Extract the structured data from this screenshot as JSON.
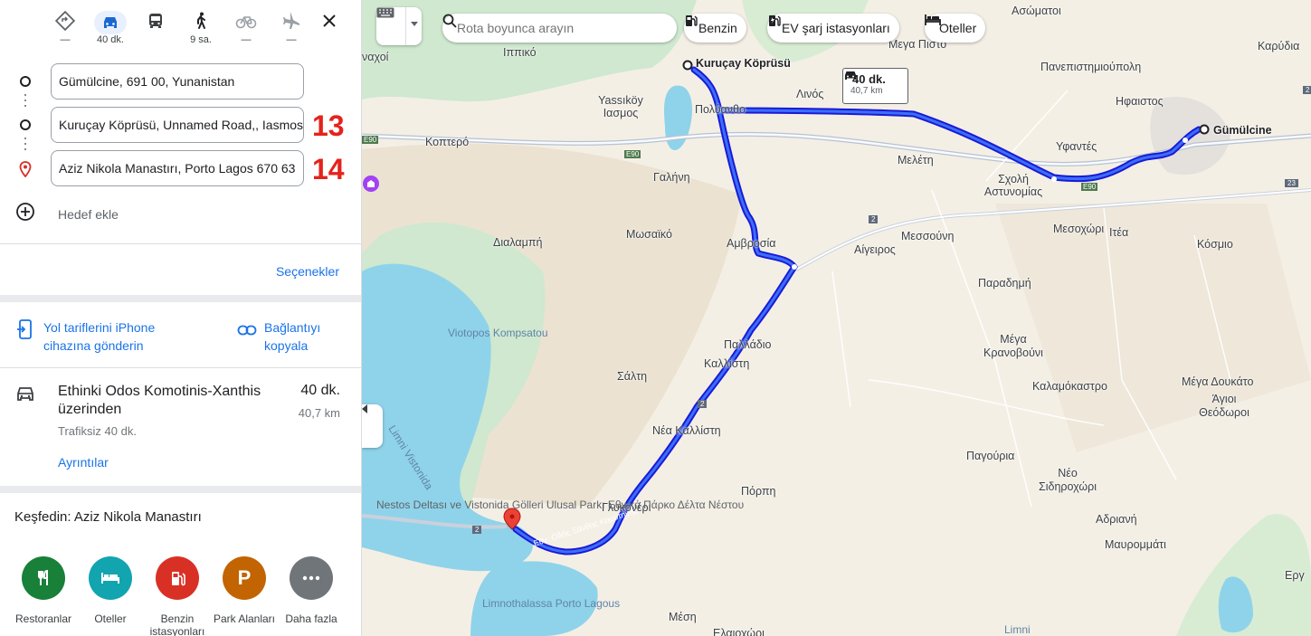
{
  "modes": [
    {
      "name": "best-route",
      "label": "—"
    },
    {
      "name": "driving",
      "label": "40 dk."
    },
    {
      "name": "transit",
      "label": ""
    },
    {
      "name": "walking",
      "label": "9 sa."
    },
    {
      "name": "cycling",
      "label": "—"
    },
    {
      "name": "flights",
      "label": "—"
    }
  ],
  "route": {
    "origin": "Gümülcine, 691 00, Yunanistan",
    "waypoint": "Kuruçay Köprüsü, Unnamed Road,, Iasmos",
    "destination": "Aziz Nikola Manastırı, Porto Lagos 670 63",
    "waypoint_badge": "13",
    "destination_badge": "14",
    "add_destination": "Hedef ekle"
  },
  "options_label": "Seçenekler",
  "share": {
    "send_phone": "Yol tariflerini iPhone cihazına gönderin",
    "copy_link": "Bağlantıyı kopyala"
  },
  "route_option": {
    "title": "Ethinki Odos Komotinis-Xanthis üzerinden",
    "duration": "40 dk.",
    "distance": "40,7 km",
    "traffic": "Trafiksiz 40 dk.",
    "details": "Ayrıntılar"
  },
  "explore": {
    "title": "Keşfedin: Aziz Nikola Manastırı",
    "categories": [
      {
        "label": "Restoranlar",
        "color": "#188038",
        "icon": "restaurant-icon"
      },
      {
        "label": "Oteller",
        "color": "#12a4af",
        "icon": "hotel-icon"
      },
      {
        "label": "Benzin istasyonları",
        "color": "#d93025",
        "icon": "gas-station-icon"
      },
      {
        "label": "Park Alanları",
        "color": "#c26401",
        "icon": "parking-icon"
      },
      {
        "label": "Daha fazla",
        "color": "#70757a",
        "icon": "more-icon"
      }
    ]
  },
  "search": {
    "placeholder": "Rota boyunca arayın"
  },
  "chips": [
    "Benzin",
    "EV şarj istasyonları",
    "Oteller"
  ],
  "map": {
    "tooltip": {
      "duration": "40 dk.",
      "distance": "40,7 km"
    },
    "markers": {
      "start": "Kuruçay Köprüsü",
      "end": "Gümülcine"
    },
    "road_labels": {
      "e90a": "E90",
      "e90b": "E90",
      "e90c": "E90",
      "r2a": "2",
      "r2b": "2",
      "r2c": "2",
      "r2d": "2",
      "r23": "23",
      "ethnikis": "Εθν. Οδός Ξάνθης Κομοτηνής"
    },
    "places": [
      {
        "id": "asomatoi",
        "text": "Ασώματοι"
      },
      {
        "id": "megapisto",
        "text": "Μεγα Πιστο"
      },
      {
        "id": "karydia",
        "text": "Καρύδια"
      },
      {
        "id": "panepistimio",
        "text": "Πανεπιστημιούπολη"
      },
      {
        "id": "ippiko",
        "text": "Ιππικό"
      },
      {
        "id": "nachoi",
        "text": "ναχοί"
      },
      {
        "id": "ifaistos",
        "text": "Ηφαιστος"
      },
      {
        "id": "linos",
        "text": "Λινός"
      },
      {
        "id": "yassikoy",
        "text": "Yassıköy Ιασμος"
      },
      {
        "id": "polyanthos",
        "text": "Πολύανθο"
      },
      {
        "id": "kopteros",
        "text": "Κοπτερό"
      },
      {
        "id": "yfantes",
        "text": "Υφαντές"
      },
      {
        "id": "meleti",
        "text": "Μελέτη"
      },
      {
        "id": "scholi",
        "text": "Σχολή Αστυνομίας"
      },
      {
        "id": "galini",
        "text": "Γαλήνη"
      },
      {
        "id": "mesochori",
        "text": "Μεσοχώρι"
      },
      {
        "id": "itea",
        "text": "Ιτέα"
      },
      {
        "id": "kosmio",
        "text": "Κόσμιο"
      },
      {
        "id": "dialampi",
        "text": "Διαλαμπή"
      },
      {
        "id": "mosaiko",
        "text": "Μωσαϊκό"
      },
      {
        "id": "amvrosia",
        "text": "Αμβροσία"
      },
      {
        "id": "messouni",
        "text": "Μεσσούνη"
      },
      {
        "id": "aigeiros",
        "text": "Αίγειρος"
      },
      {
        "id": "paradimi",
        "text": "Παραδημή"
      },
      {
        "id": "palladio",
        "text": "Παλλάδιο"
      },
      {
        "id": "kallisti",
        "text": "Καλλίστη"
      },
      {
        "id": "megakrano",
        "text": "Μέγα Κρανοβούνι"
      },
      {
        "id": "salti",
        "text": "Σάλτη"
      },
      {
        "id": "kalamokastro",
        "text": "Καλαμόκαστρο"
      },
      {
        "id": "megadoukato",
        "text": "Μέγα Δουκάτο"
      },
      {
        "id": "agioi",
        "text": "Άγιοι Θεόδωροι"
      },
      {
        "id": "neakallisti",
        "text": "Νέα Καλλίστη"
      },
      {
        "id": "pagouria",
        "text": "Παγούρια"
      },
      {
        "id": "neo",
        "text": "Νέο Σιδηροχώρι"
      },
      {
        "id": "porpi",
        "text": "Πόρπη"
      },
      {
        "id": "glykoneri",
        "text": "Γλυκονέρι"
      },
      {
        "id": "adriani",
        "text": "Αδριανή"
      },
      {
        "id": "mavrommati",
        "text": "Μαυρομμάτι"
      },
      {
        "id": "mesi",
        "text": "Μέση"
      },
      {
        "id": "erg",
        "text": "Εργ"
      },
      {
        "id": "elaiochori",
        "text": "Ελαιοχώρι"
      }
    ],
    "water": [
      {
        "id": "viotopos",
        "text": "Viotopos Kompsatou"
      },
      {
        "id": "limni",
        "text": "Limni Vistonida"
      },
      {
        "id": "nestos",
        "text": "Nestos Deltası ve Vistonida Gölleri Ulusal Parkı Εθνικό Πάρκο Δέλτα Νέστου"
      },
      {
        "id": "limnothalassa",
        "text": "Limnothalassa Porto Lagous"
      },
      {
        "id": "limni2",
        "text": "Limni"
      }
    ]
  }
}
